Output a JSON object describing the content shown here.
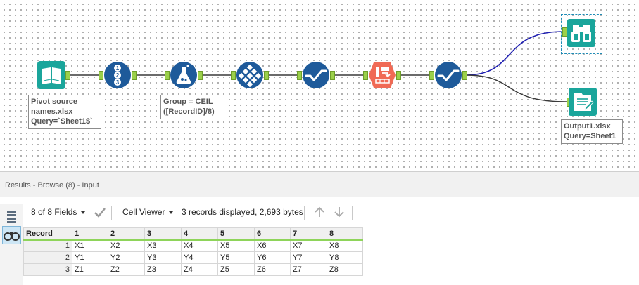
{
  "workflow": {
    "tools": [
      {
        "name": "input",
        "icon": "book-icon",
        "color": "#1aa59b"
      },
      {
        "name": "record-id",
        "icon": "record-id-icon",
        "color": "#1e5a9a"
      },
      {
        "name": "formula",
        "icon": "formula-flask-icon",
        "color": "#1e5a9a"
      },
      {
        "name": "multi-row",
        "icon": "grid-diamond-icon",
        "color": "#1e5a9a"
      },
      {
        "name": "select",
        "icon": "check-wave-icon",
        "color": "#1e5a9a"
      },
      {
        "name": "cross-tab",
        "icon": "cross-tab-icon",
        "color": "#f06a55"
      },
      {
        "name": "select-2",
        "icon": "check-wave-icon",
        "color": "#1e5a9a"
      },
      {
        "name": "browse",
        "icon": "binoculars-icon",
        "color": "#1aa59b"
      },
      {
        "name": "output",
        "icon": "output-doc-icon",
        "color": "#1aa59b"
      }
    ],
    "annotations": {
      "input": [
        "Pivot source",
        "names.xlsx",
        "Query=`Sheet1$`"
      ],
      "formula": [
        "Group = CEIL",
        "([RecordID]/8)"
      ],
      "output": [
        "Output1.xlsx",
        "Query=Sheet1"
      ]
    },
    "wire_colors": {
      "default": "#3a3a3a",
      "selected": "#1f1fb0"
    }
  },
  "results": {
    "title": "Results - Browse (8) - Input",
    "fields_label": "8 of 8 Fields",
    "viewer_label": "Cell Viewer",
    "summary": "3 records displayed, 2,693 bytes",
    "columns": [
      "Record",
      "1",
      "2",
      "3",
      "4",
      "5",
      "6",
      "7",
      "8"
    ],
    "rows": [
      [
        "1",
        "X1",
        "X2",
        "X3",
        "X4",
        "X5",
        "X6",
        "X7",
        "X8"
      ],
      [
        "2",
        "Y1",
        "Y2",
        "Y3",
        "Y4",
        "Y5",
        "Y6",
        "Y7",
        "Y8"
      ],
      [
        "3",
        "Z1",
        "Z2",
        "Z3",
        "Z4",
        "Z5",
        "Z6",
        "Z7",
        "Z8"
      ]
    ]
  }
}
